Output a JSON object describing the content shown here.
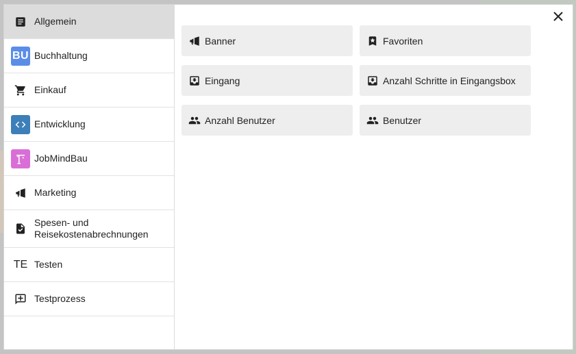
{
  "sidebar": {
    "items": [
      {
        "label": "Allgemein",
        "icon": "article-icon",
        "active": true
      },
      {
        "label": "Buchhaltung",
        "icon": "badge",
        "badge_text": "BU",
        "badge_color": "#5b8de8"
      },
      {
        "label": "Einkauf",
        "icon": "cart-icon"
      },
      {
        "label": "Entwicklung",
        "icon": "code-icon",
        "badge_color": "#3d7fb8"
      },
      {
        "label": "JobMindBau",
        "icon": "crane-icon",
        "badge_color": "#d96fd6"
      },
      {
        "label": "Marketing",
        "icon": "megaphone-icon"
      },
      {
        "label": "Spesen- und Reisekostenabrechnungen",
        "icon": "document-check-icon"
      },
      {
        "label": "Testen",
        "icon": "text-badge",
        "badge_text": "TE"
      },
      {
        "label": "Testprozess",
        "icon": "comment-add-icon"
      }
    ]
  },
  "tiles": [
    {
      "label": "Banner",
      "icon": "megaphone-icon"
    },
    {
      "label": "Favoriten",
      "icon": "bookmark-star-icon"
    },
    {
      "label": "Eingang",
      "icon": "inbox-icon"
    },
    {
      "label": "Anzahl Schritte in Eingangsbox",
      "icon": "inbox-icon"
    },
    {
      "label": "Anzahl Benutzer",
      "icon": "people-icon"
    },
    {
      "label": "Benutzer",
      "icon": "people-icon"
    }
  ],
  "colors": {
    "active_bg": "#dcdcdc",
    "tile_bg": "#eeeeee"
  }
}
